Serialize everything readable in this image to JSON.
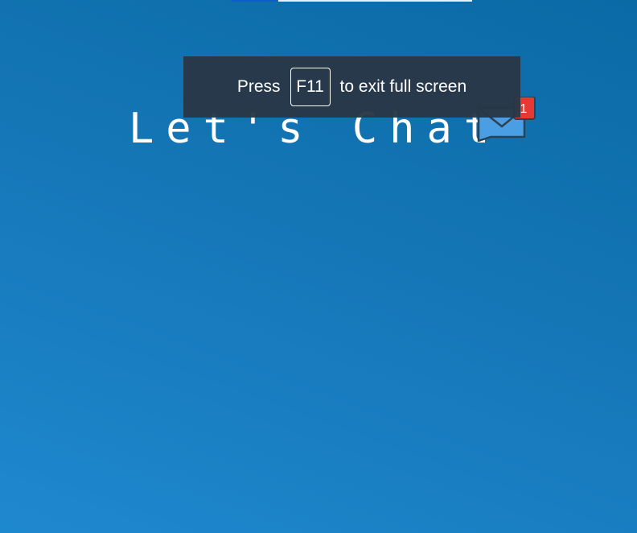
{
  "hero": {
    "title": "Let's Chat",
    "icon": "mail-icon",
    "badge_count": "1"
  },
  "fullscreen_toast": {
    "prefix": "Press",
    "key": "F11",
    "suffix": "to exit full screen"
  },
  "colors": {
    "background_top": "#0a6aa6",
    "background_bottom": "#1e88cf",
    "toast_background": "#293746",
    "envelope": "#4a9ee3",
    "envelope_outline": "#2b4256",
    "badge": "#e53935"
  }
}
